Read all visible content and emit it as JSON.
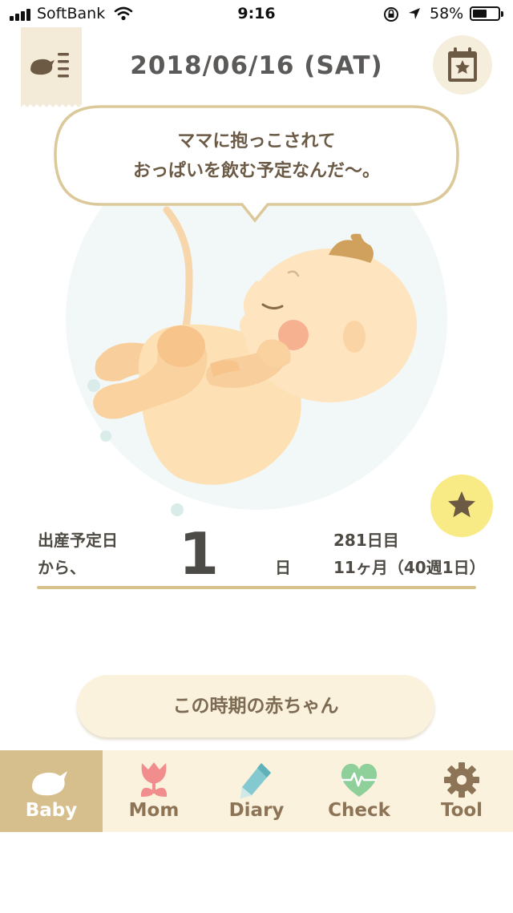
{
  "status_bar": {
    "carrier": "SoftBank",
    "time": "9:16",
    "battery": "58%",
    "battery_level": 0.58
  },
  "header": {
    "date": "2018/06/16 (SAT)",
    "menu_icon": "bird-menu-icon",
    "calendar_icon": "calendar-star-icon"
  },
  "bubble": {
    "line1": "ママに抱っこされて",
    "line2": "おっぱいを飲む予定なんだ〜。"
  },
  "info": {
    "label_line1": "出産予定日",
    "label_line2": "から、",
    "days": "1",
    "days_unit": "日",
    "day_count": "281日目",
    "age": "11ヶ月（40週1日）"
  },
  "action_button": "この時期の赤ちゃん",
  "tabs": [
    {
      "label": "Baby",
      "icon": "bird-icon",
      "active": true
    },
    {
      "label": "Mom",
      "icon": "tulip-icon",
      "active": false
    },
    {
      "label": "Diary",
      "icon": "pencil-icon",
      "active": false
    },
    {
      "label": "Check",
      "icon": "heart-pulse-icon",
      "active": false
    },
    {
      "label": "Tool",
      "icon": "gear-icon",
      "active": false
    }
  ],
  "colors": {
    "accent": "#d6bf8d",
    "tab_bar": "#fbf2de",
    "star_button": "#f8ea85",
    "bubble_border": "#dcc99a"
  }
}
